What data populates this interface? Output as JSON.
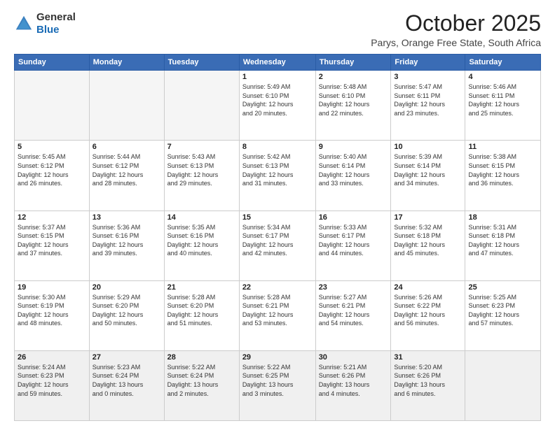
{
  "header": {
    "logo_general": "General",
    "logo_blue": "Blue",
    "month_title": "October 2025",
    "location": "Parys, Orange Free State, South Africa"
  },
  "weekdays": [
    "Sunday",
    "Monday",
    "Tuesday",
    "Wednesday",
    "Thursday",
    "Friday",
    "Saturday"
  ],
  "weeks": [
    [
      {
        "day": "",
        "info": ""
      },
      {
        "day": "",
        "info": ""
      },
      {
        "day": "",
        "info": ""
      },
      {
        "day": "1",
        "info": "Sunrise: 5:49 AM\nSunset: 6:10 PM\nDaylight: 12 hours\nand 20 minutes."
      },
      {
        "day": "2",
        "info": "Sunrise: 5:48 AM\nSunset: 6:10 PM\nDaylight: 12 hours\nand 22 minutes."
      },
      {
        "day": "3",
        "info": "Sunrise: 5:47 AM\nSunset: 6:11 PM\nDaylight: 12 hours\nand 23 minutes."
      },
      {
        "day": "4",
        "info": "Sunrise: 5:46 AM\nSunset: 6:11 PM\nDaylight: 12 hours\nand 25 minutes."
      }
    ],
    [
      {
        "day": "5",
        "info": "Sunrise: 5:45 AM\nSunset: 6:12 PM\nDaylight: 12 hours\nand 26 minutes."
      },
      {
        "day": "6",
        "info": "Sunrise: 5:44 AM\nSunset: 6:12 PM\nDaylight: 12 hours\nand 28 minutes."
      },
      {
        "day": "7",
        "info": "Sunrise: 5:43 AM\nSunset: 6:13 PM\nDaylight: 12 hours\nand 29 minutes."
      },
      {
        "day": "8",
        "info": "Sunrise: 5:42 AM\nSunset: 6:13 PM\nDaylight: 12 hours\nand 31 minutes."
      },
      {
        "day": "9",
        "info": "Sunrise: 5:40 AM\nSunset: 6:14 PM\nDaylight: 12 hours\nand 33 minutes."
      },
      {
        "day": "10",
        "info": "Sunrise: 5:39 AM\nSunset: 6:14 PM\nDaylight: 12 hours\nand 34 minutes."
      },
      {
        "day": "11",
        "info": "Sunrise: 5:38 AM\nSunset: 6:15 PM\nDaylight: 12 hours\nand 36 minutes."
      }
    ],
    [
      {
        "day": "12",
        "info": "Sunrise: 5:37 AM\nSunset: 6:15 PM\nDaylight: 12 hours\nand 37 minutes."
      },
      {
        "day": "13",
        "info": "Sunrise: 5:36 AM\nSunset: 6:16 PM\nDaylight: 12 hours\nand 39 minutes."
      },
      {
        "day": "14",
        "info": "Sunrise: 5:35 AM\nSunset: 6:16 PM\nDaylight: 12 hours\nand 40 minutes."
      },
      {
        "day": "15",
        "info": "Sunrise: 5:34 AM\nSunset: 6:17 PM\nDaylight: 12 hours\nand 42 minutes."
      },
      {
        "day": "16",
        "info": "Sunrise: 5:33 AM\nSunset: 6:17 PM\nDaylight: 12 hours\nand 44 minutes."
      },
      {
        "day": "17",
        "info": "Sunrise: 5:32 AM\nSunset: 6:18 PM\nDaylight: 12 hours\nand 45 minutes."
      },
      {
        "day": "18",
        "info": "Sunrise: 5:31 AM\nSunset: 6:18 PM\nDaylight: 12 hours\nand 47 minutes."
      }
    ],
    [
      {
        "day": "19",
        "info": "Sunrise: 5:30 AM\nSunset: 6:19 PM\nDaylight: 12 hours\nand 48 minutes."
      },
      {
        "day": "20",
        "info": "Sunrise: 5:29 AM\nSunset: 6:20 PM\nDaylight: 12 hours\nand 50 minutes."
      },
      {
        "day": "21",
        "info": "Sunrise: 5:28 AM\nSunset: 6:20 PM\nDaylight: 12 hours\nand 51 minutes."
      },
      {
        "day": "22",
        "info": "Sunrise: 5:28 AM\nSunset: 6:21 PM\nDaylight: 12 hours\nand 53 minutes."
      },
      {
        "day": "23",
        "info": "Sunrise: 5:27 AM\nSunset: 6:21 PM\nDaylight: 12 hours\nand 54 minutes."
      },
      {
        "day": "24",
        "info": "Sunrise: 5:26 AM\nSunset: 6:22 PM\nDaylight: 12 hours\nand 56 minutes."
      },
      {
        "day": "25",
        "info": "Sunrise: 5:25 AM\nSunset: 6:23 PM\nDaylight: 12 hours\nand 57 minutes."
      }
    ],
    [
      {
        "day": "26",
        "info": "Sunrise: 5:24 AM\nSunset: 6:23 PM\nDaylight: 12 hours\nand 59 minutes."
      },
      {
        "day": "27",
        "info": "Sunrise: 5:23 AM\nSunset: 6:24 PM\nDaylight: 13 hours\nand 0 minutes."
      },
      {
        "day": "28",
        "info": "Sunrise: 5:22 AM\nSunset: 6:24 PM\nDaylight: 13 hours\nand 2 minutes."
      },
      {
        "day": "29",
        "info": "Sunrise: 5:22 AM\nSunset: 6:25 PM\nDaylight: 13 hours\nand 3 minutes."
      },
      {
        "day": "30",
        "info": "Sunrise: 5:21 AM\nSunset: 6:26 PM\nDaylight: 13 hours\nand 4 minutes."
      },
      {
        "day": "31",
        "info": "Sunrise: 5:20 AM\nSunset: 6:26 PM\nDaylight: 13 hours\nand 6 minutes."
      },
      {
        "day": "",
        "info": ""
      }
    ]
  ]
}
